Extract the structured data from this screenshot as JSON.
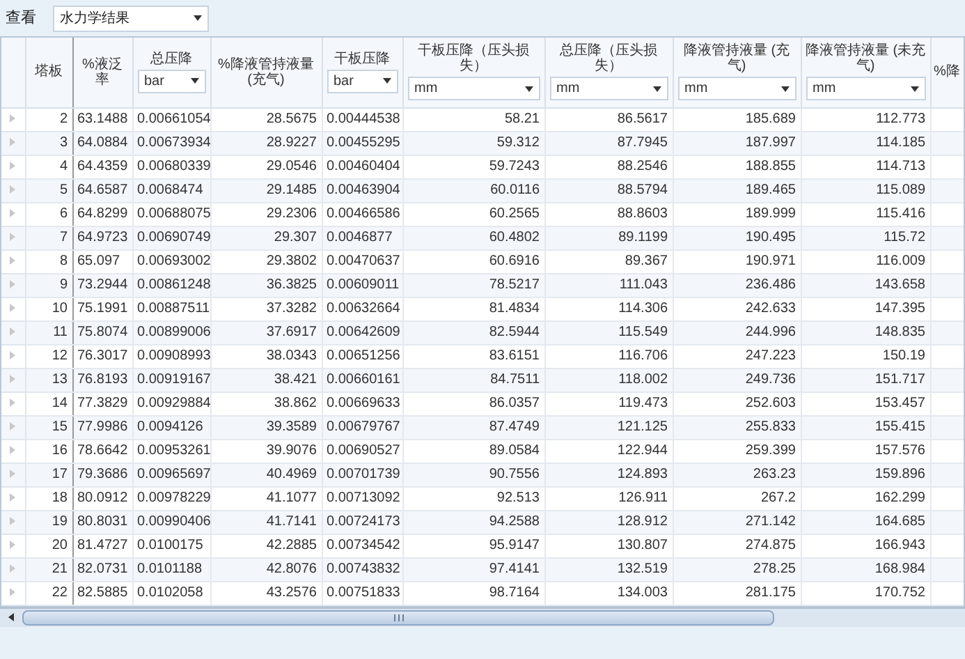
{
  "toolbar": {
    "label": "查看",
    "dropdown": "水力学结果"
  },
  "table": {
    "columns": [
      {
        "title": "塔板"
      },
      {
        "title": "%液泛率"
      },
      {
        "title": "总压降",
        "unit": "bar"
      },
      {
        "title": "%降液管持液量 (充气)"
      },
      {
        "title": "干板压降",
        "unit": "bar"
      },
      {
        "title": "干板压降（压头损失）",
        "unit": "mm"
      },
      {
        "title": "总压降（压头损失）",
        "unit": "mm"
      },
      {
        "title": "降液管持液量 (充气)",
        "unit": "mm"
      },
      {
        "title": "降液管持液量 (未充气)",
        "unit": "mm"
      },
      {
        "title": "%降"
      }
    ],
    "rows": [
      [
        "2",
        "63.1488",
        "0.00661054",
        "28.5675",
        "0.00444538",
        "58.21",
        "86.5617",
        "185.689",
        "112.773"
      ],
      [
        "3",
        "64.0884",
        "0.00673934",
        "28.9227",
        "0.00455295",
        "59.312",
        "87.7945",
        "187.997",
        "114.185"
      ],
      [
        "4",
        "64.4359",
        "0.00680339",
        "29.0546",
        "0.00460404",
        "59.7243",
        "88.2546",
        "188.855",
        "114.713"
      ],
      [
        "5",
        "64.6587",
        "0.0068474",
        "29.1485",
        "0.00463904",
        "60.0116",
        "88.5794",
        "189.465",
        "115.089"
      ],
      [
        "6",
        "64.8299",
        "0.00688075",
        "29.2306",
        "0.00466586",
        "60.2565",
        "88.8603",
        "189.999",
        "115.416"
      ],
      [
        "7",
        "64.9723",
        "0.00690749",
        "29.307",
        "0.0046877",
        "60.4802",
        "89.1199",
        "190.495",
        "115.72"
      ],
      [
        "8",
        "65.097",
        "0.00693002",
        "29.3802",
        "0.00470637",
        "60.6916",
        "89.367",
        "190.971",
        "116.009"
      ],
      [
        "9",
        "73.2944",
        "0.00861248",
        "36.3825",
        "0.00609011",
        "78.5217",
        "111.043",
        "236.486",
        "143.658"
      ],
      [
        "10",
        "75.1991",
        "0.00887511",
        "37.3282",
        "0.00632664",
        "81.4834",
        "114.306",
        "242.633",
        "147.395"
      ],
      [
        "11",
        "75.8074",
        "0.00899006",
        "37.6917",
        "0.00642609",
        "82.5944",
        "115.549",
        "244.996",
        "148.835"
      ],
      [
        "12",
        "76.3017",
        "0.00908993",
        "38.0343",
        "0.00651256",
        "83.6151",
        "116.706",
        "247.223",
        "150.19"
      ],
      [
        "13",
        "76.8193",
        "0.00919167",
        "38.421",
        "0.00660161",
        "84.7511",
        "118.002",
        "249.736",
        "151.717"
      ],
      [
        "14",
        "77.3829",
        "0.00929884",
        "38.862",
        "0.00669633",
        "86.0357",
        "119.473",
        "252.603",
        "153.457"
      ],
      [
        "15",
        "77.9986",
        "0.0094126",
        "39.3589",
        "0.00679767",
        "87.4749",
        "121.125",
        "255.833",
        "155.415"
      ],
      [
        "16",
        "78.6642",
        "0.00953261",
        "39.9076",
        "0.00690527",
        "89.0584",
        "122.944",
        "259.399",
        "157.576"
      ],
      [
        "17",
        "79.3686",
        "0.00965697",
        "40.4969",
        "0.00701739",
        "90.7556",
        "124.893",
        "263.23",
        "159.896"
      ],
      [
        "18",
        "80.0912",
        "0.00978229",
        "41.1077",
        "0.00713092",
        "92.513",
        "126.911",
        "267.2",
        "162.299"
      ],
      [
        "19",
        "80.8031",
        "0.00990406",
        "41.7141",
        "0.00724173",
        "94.2588",
        "128.912",
        "271.142",
        "164.685"
      ],
      [
        "20",
        "81.4727",
        "0.0100175",
        "42.2885",
        "0.00734542",
        "95.9147",
        "130.807",
        "274.875",
        "166.943"
      ],
      [
        "21",
        "82.0731",
        "0.0101188",
        "42.8076",
        "0.00743832",
        "97.4141",
        "132.519",
        "278.25",
        "168.984"
      ],
      [
        "22",
        "82.5885",
        "0.0102058",
        "43.2576",
        "0.00751833",
        "98.7164",
        "134.003",
        "281.175",
        "170.752"
      ]
    ]
  }
}
